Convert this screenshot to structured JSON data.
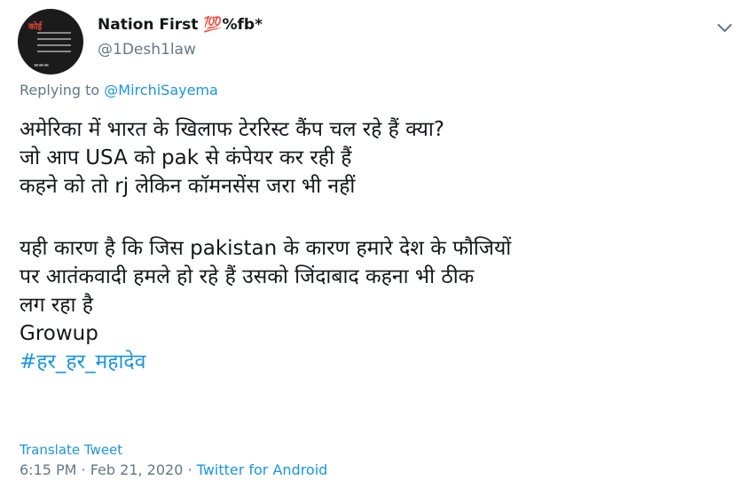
{
  "author": {
    "name": "Nation First 💯%fb*",
    "handle": "@1Desh1law"
  },
  "reply": {
    "prefix": "Replying to ",
    "mention": "@MirchiSayema"
  },
  "tweet": {
    "lines": [
      "अमेरिका में भारत के खिलाफ टेररिस्ट कैंप चल रहे हैं क्या?",
      "जो आप USA को pak  से कंपेयर कर रही हैं",
      "कहने को तो rj लेकिन कॉमनसेंस जरा भी नहीं",
      "यही कारण है कि जिस pakistan के कारण हमारे देश के फौजियों",
      "पर आतंकवादी हमले हो रहे हैं उसको जिंदाबाद कहना भी ठीक",
      "लग रहा है",
      "Growup"
    ],
    "hashtag": "#हर_हर_महादेव"
  },
  "footer": {
    "translate": "Translate Tweet",
    "time": "6:15 PM · Feb 21, 2020 · ",
    "source": "Twitter for Android"
  },
  "icons": {
    "menu": "chevron-down-icon"
  },
  "colors": {
    "accent": "#1b95e0",
    "secondary_text": "#657786",
    "primary_text": "#14171a"
  }
}
